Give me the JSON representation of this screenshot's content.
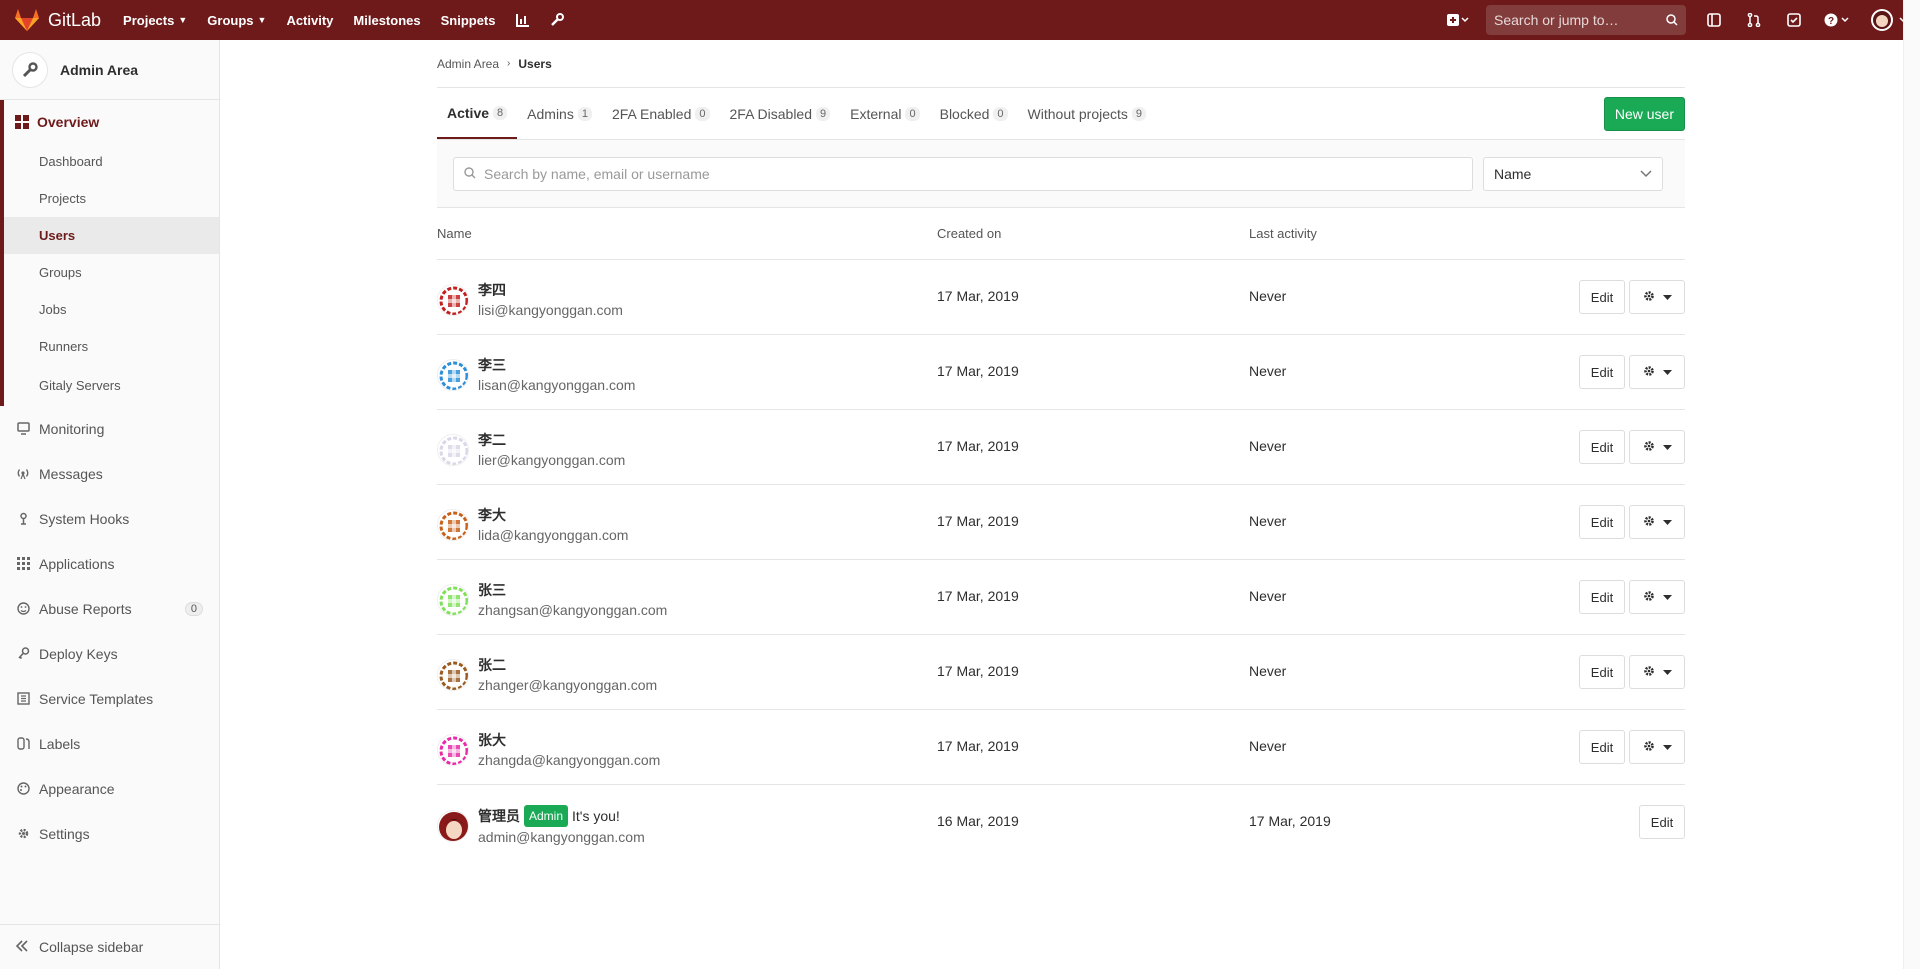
{
  "navbar": {
    "brand": "GitLab",
    "items": [
      {
        "label": "Projects",
        "dropdown": true
      },
      {
        "label": "Groups",
        "dropdown": true
      },
      {
        "label": "Activity",
        "dropdown": false
      },
      {
        "label": "Milestones",
        "dropdown": false
      },
      {
        "label": "Snippets",
        "dropdown": false
      }
    ],
    "search_placeholder": "Search or jump to…",
    "color": "#6e1a1b"
  },
  "sidebar": {
    "title": "Admin Area",
    "overview": {
      "label": "Overview",
      "items": [
        "Dashboard",
        "Projects",
        "Users",
        "Groups",
        "Jobs",
        "Runners",
        "Gitaly Servers"
      ],
      "current": "Users"
    },
    "items": [
      {
        "label": "Monitoring",
        "icon": "monitor-icon"
      },
      {
        "label": "Messages",
        "icon": "broadcast-icon"
      },
      {
        "label": "System Hooks",
        "icon": "hook-icon"
      },
      {
        "label": "Applications",
        "icon": "apps-icon"
      },
      {
        "label": "Abuse Reports",
        "icon": "smiley-icon",
        "count": "0"
      },
      {
        "label": "Deploy Keys",
        "icon": "key-icon"
      },
      {
        "label": "Service Templates",
        "icon": "template-icon"
      },
      {
        "label": "Labels",
        "icon": "labels-icon"
      },
      {
        "label": "Appearance",
        "icon": "palette-icon"
      },
      {
        "label": "Settings",
        "icon": "gear-icon"
      }
    ],
    "collapse_label": "Collapse sidebar"
  },
  "breadcrumb": [
    "Admin Area",
    "Users"
  ],
  "tabs": [
    {
      "label": "Active",
      "count": "8"
    },
    {
      "label": "Admins",
      "count": "1"
    },
    {
      "label": "2FA Enabled",
      "count": "0"
    },
    {
      "label": "2FA Disabled",
      "count": "9"
    },
    {
      "label": "External",
      "count": "0"
    },
    {
      "label": "Blocked",
      "count": "0"
    },
    {
      "label": "Without projects",
      "count": "9"
    }
  ],
  "new_user_label": "New user",
  "filter": {
    "search_placeholder": "Search by name, email or username",
    "sort_value": "Name"
  },
  "table": {
    "headers": {
      "name": "Name",
      "created": "Created on",
      "activity": "Last activity"
    },
    "edit_label": "Edit",
    "rows": [
      {
        "name": "李四",
        "email": "lisi@kangyonggan.com",
        "created": "17 Mar, 2019",
        "activity": "Never",
        "color": "#c0201f"
      },
      {
        "name": "李三",
        "email": "lisan@kangyonggan.com",
        "created": "17 Mar, 2019",
        "activity": "Never",
        "color": "#2a8fd8"
      },
      {
        "name": "李二",
        "email": "lier@kangyonggan.com",
        "created": "17 Mar, 2019",
        "activity": "Never",
        "color": "#d8d8e8"
      },
      {
        "name": "李大",
        "email": "lida@kangyonggan.com",
        "created": "17 Mar, 2019",
        "activity": "Never",
        "color": "#c8601a"
      },
      {
        "name": "张三",
        "email": "zhangsan@kangyonggan.com",
        "created": "17 Mar, 2019",
        "activity": "Never",
        "color": "#7fe05a"
      },
      {
        "name": "张二",
        "email": "zhanger@kangyonggan.com",
        "created": "17 Mar, 2019",
        "activity": "Never",
        "color": "#9a5a20"
      },
      {
        "name": "张大",
        "email": "zhangda@kangyonggan.com",
        "created": "17 Mar, 2019",
        "activity": "Never",
        "color": "#e82aa8"
      },
      {
        "name": "管理员",
        "email": "admin@kangyonggan.com",
        "created": "16 Mar, 2019",
        "activity": "17 Mar, 2019",
        "color": "#8a1a1a",
        "badge": "Admin",
        "note": "It's you!"
      }
    ]
  }
}
